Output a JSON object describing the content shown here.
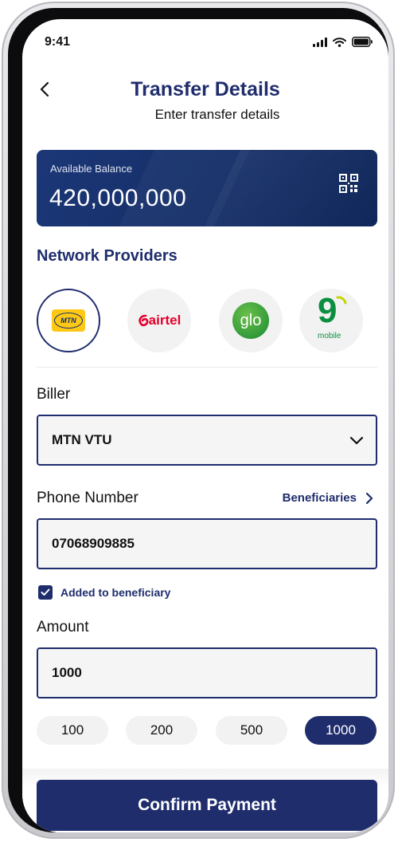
{
  "status_bar": {
    "time": "9:41"
  },
  "header": {
    "title": "Transfer Details",
    "subtitle": "Enter transfer details"
  },
  "balance": {
    "label": "Available Balance",
    "value": "420,000,000"
  },
  "network": {
    "title": "Network Providers",
    "providers": [
      {
        "name": "MTN",
        "logo_text": "MTN",
        "selected": true
      },
      {
        "name": "airtel",
        "logo_text": "airtel",
        "selected": false
      },
      {
        "name": "glo",
        "logo_text": "glo",
        "selected": false
      },
      {
        "name": "9mobile",
        "logo_text": "9",
        "logo_subtext": "mobile",
        "selected": false
      }
    ]
  },
  "biller": {
    "label": "Biller",
    "value": "MTN VTU"
  },
  "phone": {
    "label": "Phone Number",
    "value": "07068909885",
    "beneficiaries_link": "Beneficiaries"
  },
  "beneficiary_check": {
    "label": "Added to beneficiary",
    "checked": true
  },
  "amount": {
    "label": "Amount",
    "value": "1000",
    "quick_amounts": [
      "100",
      "200",
      "500",
      "1000"
    ],
    "selected": "1000"
  },
  "confirm_button": {
    "label": "Confirm Payment"
  },
  "colors": {
    "primary": "#1f2d6d",
    "mtn_yellow": "#ffc815",
    "airtel_red": "#e4002b",
    "glo_green": "#198a33"
  },
  "icons": [
    "signal-icon",
    "wifi-icon",
    "battery-icon",
    "back-arrow-icon",
    "qr-code-icon",
    "chevron-down-icon",
    "chevron-right-icon",
    "check-icon"
  ]
}
